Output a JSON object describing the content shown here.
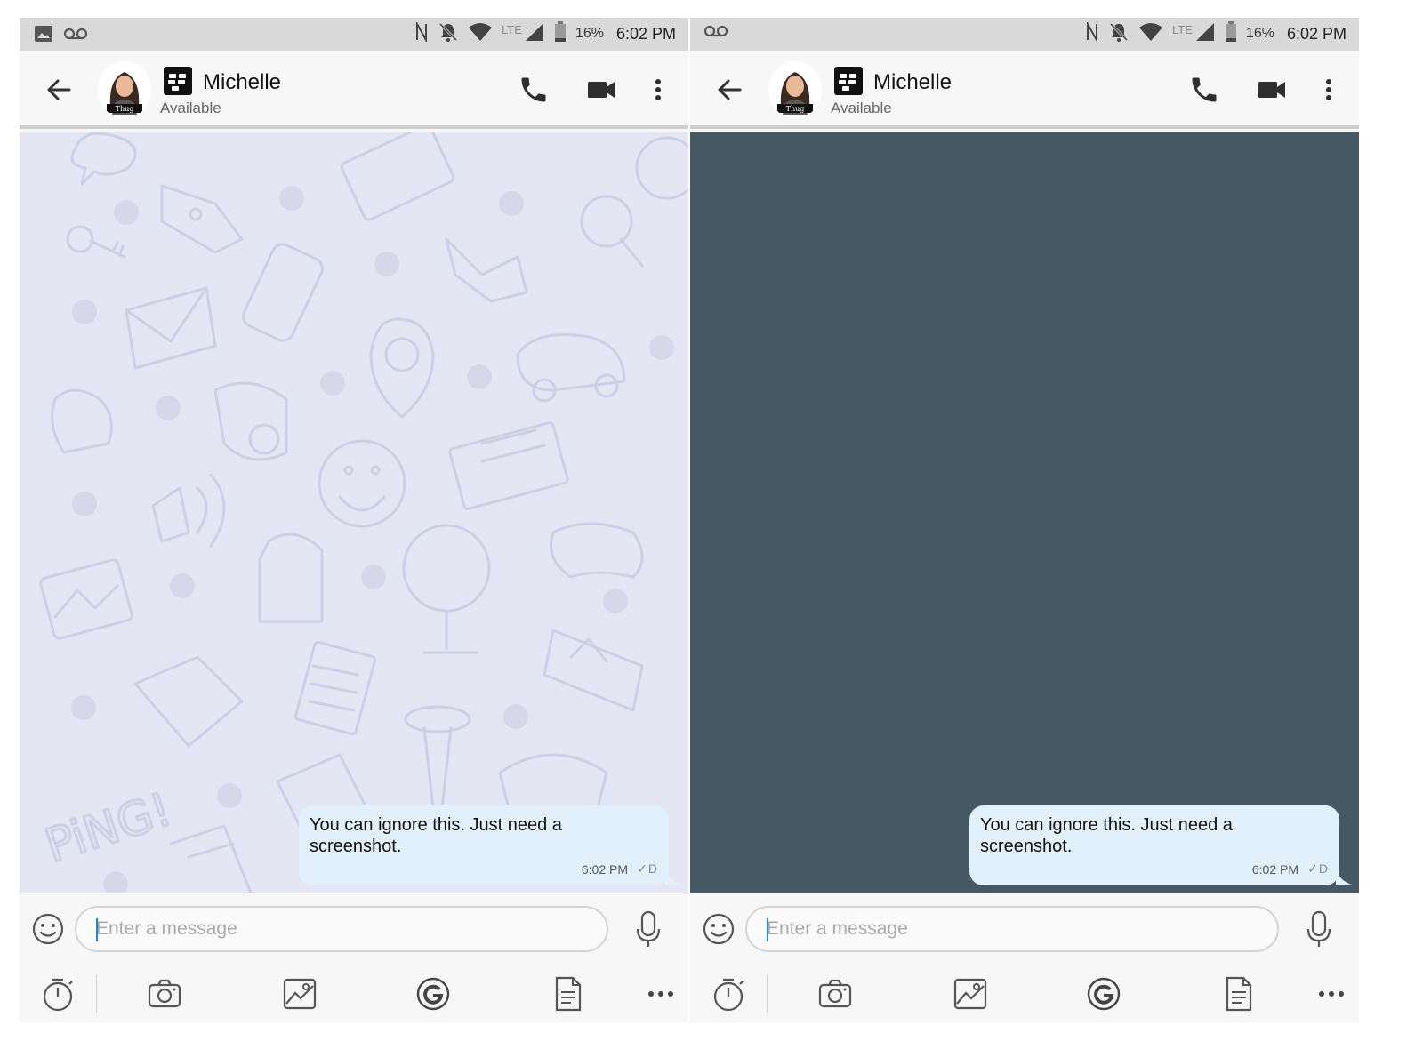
{
  "status_bar": {
    "battery_percent": "16%",
    "time": "6:02 PM",
    "network_label": "LTE"
  },
  "conversation": {
    "contact_name": "Michelle",
    "contact_status": "Available",
    "message": {
      "text": "You can ignore this. Just need a screenshot.",
      "time": "6:02 PM",
      "ack": "✓D"
    },
    "input_placeholder": "Enter a message"
  },
  "colors": {
    "statusbar_bg": "#d9d9d9",
    "appbar_bg": "#f7f7f7",
    "chat_bg_pattern": "#e4e6f4",
    "chat_bg_dark": "#465864",
    "bubble_bg": "#e1f0fa",
    "icon_color": "#2f2f2f"
  },
  "icons": {
    "status_left": [
      "image-notification-icon",
      "voicemail-icon"
    ],
    "status_right": [
      "nfc-icon",
      "notifications-off-icon",
      "wifi-icon",
      "signal-icon",
      "battery-icon"
    ],
    "appbar": [
      "back-arrow-icon",
      "avatar",
      "bbm-logo-icon",
      "phone-icon",
      "video-camera-icon",
      "more-vert-icon"
    ],
    "composer": [
      "emoji-icon",
      "microphone-icon"
    ],
    "toolbar": [
      "timer-icon",
      "camera-icon",
      "gallery-icon",
      "google-icon",
      "document-icon",
      "more-horiz-icon"
    ]
  },
  "panels": [
    {
      "id": "left",
      "background": "doodle-pattern"
    },
    {
      "id": "right",
      "background": "solid-dark"
    }
  ]
}
